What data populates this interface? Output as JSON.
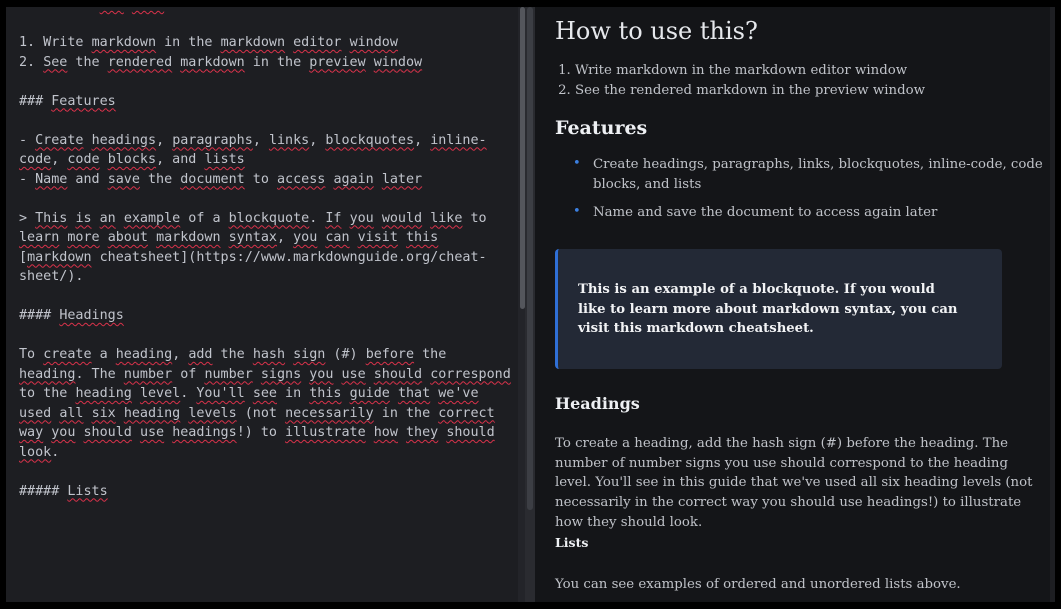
{
  "editor": {
    "lines": [
      [
        {
          "t": "## How to "
        },
        {
          "t": "use",
          "s": 1
        },
        {
          "t": " "
        },
        {
          "t": "this",
          "s": 1
        },
        {
          "t": "?"
        }
      ],
      [
        {
          "t": ""
        }
      ],
      [
        {
          "t": "1. Write "
        },
        {
          "t": "markdown",
          "s": 1
        },
        {
          "t": " in the "
        },
        {
          "t": "markdown",
          "s": 1
        },
        {
          "t": " "
        },
        {
          "t": "editor",
          "s": 1
        },
        {
          "t": " "
        },
        {
          "t": "window",
          "s": 1
        }
      ],
      [
        {
          "t": "2. "
        },
        {
          "t": "See",
          "s": 1
        },
        {
          "t": " the "
        },
        {
          "t": "rendered",
          "s": 1
        },
        {
          "t": " "
        },
        {
          "t": "markdown",
          "s": 1
        },
        {
          "t": " in the "
        },
        {
          "t": "preview",
          "s": 1
        },
        {
          "t": " "
        },
        {
          "t": "window",
          "s": 1
        }
      ],
      [
        {
          "t": ""
        }
      ],
      [
        {
          "t": "### "
        },
        {
          "t": "Features",
          "s": 1
        }
      ],
      [
        {
          "t": ""
        }
      ],
      [
        {
          "t": "- "
        },
        {
          "t": "Create",
          "s": 1
        },
        {
          "t": " "
        },
        {
          "t": "headings",
          "s": 1
        },
        {
          "t": ", "
        },
        {
          "t": "paragraphs",
          "s": 1
        },
        {
          "t": ", "
        },
        {
          "t": "links",
          "s": 1
        },
        {
          "t": ", "
        },
        {
          "t": "blockquotes",
          "s": 1
        },
        {
          "t": ", "
        },
        {
          "t": "inline-",
          "s": 1
        }
      ],
      [
        {
          "t": "code",
          "s": 1
        },
        {
          "t": ", "
        },
        {
          "t": "code",
          "s": 1
        },
        {
          "t": " "
        },
        {
          "t": "blocks",
          "s": 1
        },
        {
          "t": ", and "
        },
        {
          "t": "lists",
          "s": 1
        }
      ],
      [
        {
          "t": "- "
        },
        {
          "t": "Name",
          "s": 1
        },
        {
          "t": " and "
        },
        {
          "t": "save",
          "s": 1
        },
        {
          "t": " the "
        },
        {
          "t": "document",
          "s": 1
        },
        {
          "t": " to "
        },
        {
          "t": "access",
          "s": 1
        },
        {
          "t": " "
        },
        {
          "t": "again",
          "s": 1
        },
        {
          "t": " "
        },
        {
          "t": "later",
          "s": 1
        }
      ],
      [
        {
          "t": ""
        }
      ],
      [
        {
          "t": "> "
        },
        {
          "t": "This",
          "s": 1
        },
        {
          "t": " "
        },
        {
          "t": "is",
          "s": 1
        },
        {
          "t": " "
        },
        {
          "t": "an",
          "s": 1
        },
        {
          "t": " "
        },
        {
          "t": "example",
          "s": 1
        },
        {
          "t": " of a "
        },
        {
          "t": "blockquote",
          "s": 1
        },
        {
          "t": ". "
        },
        {
          "t": "If",
          "s": 1
        },
        {
          "t": " "
        },
        {
          "t": "you",
          "s": 1
        },
        {
          "t": " "
        },
        {
          "t": "would",
          "s": 1
        },
        {
          "t": " "
        },
        {
          "t": "like",
          "s": 1
        },
        {
          "t": " to"
        }
      ],
      [
        {
          "t": "learn",
          "s": 1
        },
        {
          "t": " "
        },
        {
          "t": "more",
          "s": 1
        },
        {
          "t": " "
        },
        {
          "t": "about",
          "s": 1
        },
        {
          "t": " "
        },
        {
          "t": "markdown",
          "s": 1
        },
        {
          "t": " "
        },
        {
          "t": "syntax",
          "s": 1
        },
        {
          "t": ", "
        },
        {
          "t": "you",
          "s": 1
        },
        {
          "t": " "
        },
        {
          "t": "can",
          "s": 1
        },
        {
          "t": " "
        },
        {
          "t": "visit",
          "s": 1
        },
        {
          "t": " "
        },
        {
          "t": "this",
          "s": 1
        }
      ],
      [
        {
          "t": "["
        },
        {
          "t": "markdown",
          "s": 1
        },
        {
          "t": " cheatsheet](https://www.markdownguide.org/cheat-"
        }
      ],
      [
        {
          "t": "sheet/)."
        }
      ],
      [
        {
          "t": ""
        }
      ],
      [
        {
          "t": "#### "
        },
        {
          "t": "Headings",
          "s": 1
        }
      ],
      [
        {
          "t": ""
        }
      ],
      [
        {
          "t": "To "
        },
        {
          "t": "create",
          "s": 1
        },
        {
          "t": " a "
        },
        {
          "t": "heading",
          "s": 1
        },
        {
          "t": ", "
        },
        {
          "t": "add",
          "s": 1
        },
        {
          "t": " the "
        },
        {
          "t": "hash",
          "s": 1
        },
        {
          "t": " "
        },
        {
          "t": "sign",
          "s": 1
        },
        {
          "t": " (#) "
        },
        {
          "t": "before",
          "s": 1
        },
        {
          "t": " the"
        }
      ],
      [
        {
          "t": "heading",
          "s": 1
        },
        {
          "t": ". The "
        },
        {
          "t": "number",
          "s": 1
        },
        {
          "t": " of "
        },
        {
          "t": "number",
          "s": 1
        },
        {
          "t": " "
        },
        {
          "t": "signs",
          "s": 1
        },
        {
          "t": " "
        },
        {
          "t": "you",
          "s": 1
        },
        {
          "t": " "
        },
        {
          "t": "use",
          "s": 1
        },
        {
          "t": " "
        },
        {
          "t": "should",
          "s": 1
        },
        {
          "t": " "
        },
        {
          "t": "correspond",
          "s": 1
        }
      ],
      [
        {
          "t": "to the "
        },
        {
          "t": "heading",
          "s": 1
        },
        {
          "t": " "
        },
        {
          "t": "level",
          "s": 1
        },
        {
          "t": ". "
        },
        {
          "t": "You'll",
          "s": 1
        },
        {
          "t": " "
        },
        {
          "t": "see",
          "s": 1
        },
        {
          "t": " in "
        },
        {
          "t": "this",
          "s": 1
        },
        {
          "t": " "
        },
        {
          "t": "guide",
          "s": 1
        },
        {
          "t": " "
        },
        {
          "t": "that",
          "s": 1
        },
        {
          "t": " "
        },
        {
          "t": "we've",
          "s": 1
        }
      ],
      [
        {
          "t": "used",
          "s": 1
        },
        {
          "t": " "
        },
        {
          "t": "all",
          "s": 1
        },
        {
          "t": " "
        },
        {
          "t": "six",
          "s": 1
        },
        {
          "t": " "
        },
        {
          "t": "heading",
          "s": 1
        },
        {
          "t": " "
        },
        {
          "t": "levels",
          "s": 1
        },
        {
          "t": " (not "
        },
        {
          "t": "necessarily",
          "s": 1
        },
        {
          "t": " in the "
        },
        {
          "t": "correct",
          "s": 1
        }
      ],
      [
        {
          "t": "way",
          "s": 1
        },
        {
          "t": " "
        },
        {
          "t": "you",
          "s": 1
        },
        {
          "t": " "
        },
        {
          "t": "should",
          "s": 1
        },
        {
          "t": " "
        },
        {
          "t": "use",
          "s": 1
        },
        {
          "t": " "
        },
        {
          "t": "headings",
          "s": 1
        },
        {
          "t": "!) to "
        },
        {
          "t": "illustrate",
          "s": 1
        },
        {
          "t": " "
        },
        {
          "t": "how",
          "s": 1
        },
        {
          "t": " "
        },
        {
          "t": "they",
          "s": 1
        },
        {
          "t": " "
        },
        {
          "t": "should",
          "s": 1
        }
      ],
      [
        {
          "t": "look",
          "s": 1
        },
        {
          "t": "."
        }
      ],
      [
        {
          "t": ""
        }
      ],
      [
        {
          "t": "##### "
        },
        {
          "t": "Lists",
          "s": 1
        }
      ]
    ]
  },
  "preview": {
    "h1": "How to use this?",
    "ordered": [
      "Write markdown in the markdown editor window",
      "See the rendered markdown in the preview window"
    ],
    "features_heading": "Features",
    "bullets": [
      "Create headings, paragraphs, links, blockquotes, inline-code, code blocks, and lists",
      "Name and save the document to access again later"
    ],
    "blockquote": "This is an example of a blockquote. If you would like to learn more about markdown syntax, you can visit this markdown cheatsheet.",
    "headings_heading": "Headings",
    "headings_paragraph": "To create a heading, add the hash sign (#) before the heading. The number of number signs you use should correspond to the heading level. You'll see in this guide that we've used all six heading levels (not necessarily in the correct way you should use headings!) to illustrate how they should look.",
    "lists_heading": "Lists",
    "lists_paragraph": "You can see examples of ordered and unordered lists above."
  }
}
